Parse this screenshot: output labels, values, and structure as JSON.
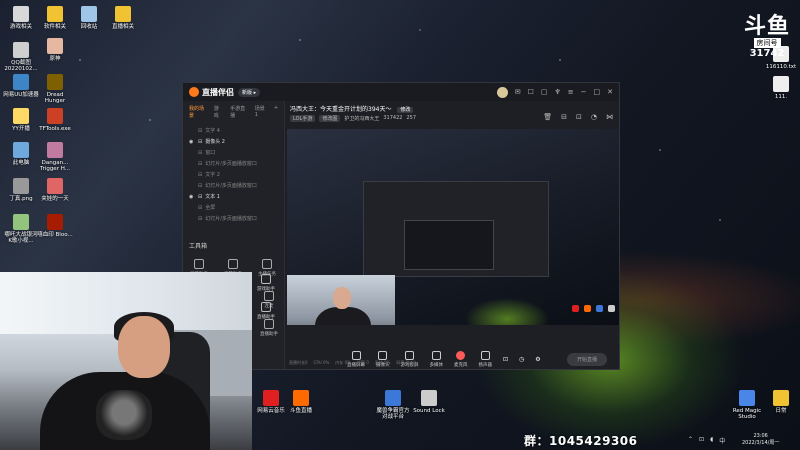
{
  "desktop": {
    "icons": [
      {
        "label": "游戏相关",
        "color": "#d8d8d8"
      },
      {
        "label": "软件相关",
        "color": "#f1c232"
      },
      {
        "label": "回收站",
        "color": "#9fc5e8"
      },
      {
        "label": "直播相关",
        "color": "#f1c232"
      },
      {
        "label": "QQ截图 20220102...",
        "color": "#cfcfcf"
      },
      {
        "label": "原神",
        "color": "#e6b8a2"
      },
      {
        "label": "网易UU加速器",
        "color": "#3d85c6"
      },
      {
        "label": "Dread Hunger",
        "color": "#7f6000"
      },
      {
        "label": "YY开播",
        "color": "#ffd966"
      },
      {
        "label": "TFTools.exe",
        "color": "#cc4125"
      },
      {
        "label": "此电脑",
        "color": "#6fa8dc"
      },
      {
        "label": "Dangan... Trigger H...",
        "color": "#c27ba0"
      },
      {
        "label": "丁真.png",
        "color": "#999999"
      },
      {
        "label": "夹娃的一天",
        "color": "#e06666"
      },
      {
        "label": "哪吒大战银河 K歌小视...",
        "color": "#93c47d"
      },
      {
        "label": "嘻血印 Bloo...",
        "color": "#a61c00"
      }
    ],
    "right_icons": [
      {
        "label": "116110.txt",
        "color": "#eeeeee"
      },
      {
        "label": "111.",
        "color": "#eeeeee"
      }
    ],
    "taskbar_icons": [
      {
        "label": "网易云音乐",
        "color": "#e02020"
      },
      {
        "label": "斗鱼直播",
        "color": "#ff6a00"
      },
      {
        "label": "魔兽争霸官方 对战平台",
        "color": "#3c78d8"
      },
      {
        "label": "Sound Lock",
        "color": "#cccccc"
      },
      {
        "label": "Red Magic Studio",
        "color": "#4a86e8"
      },
      {
        "label": "日常",
        "color": "#f1c232"
      }
    ],
    "qq_group": "群：1045429306",
    "clock_time": "23:06",
    "clock_date": "2022/3/14/周一"
  },
  "douyu": {
    "logo": "斗鱼",
    "room_label": "房间号",
    "room_id": "31742"
  },
  "app": {
    "title": "直播伴侣",
    "version": "新版 ▸",
    "tabs": [
      "我的场景",
      "游戏",
      "手游直播",
      "场景1"
    ],
    "scenes": [
      {
        "name": "文字 4",
        "visible": false
      },
      {
        "name": "摄像头 2",
        "visible": true
      },
      {
        "name": "窗口",
        "visible": false
      },
      {
        "name": "幻灯片/多页面播放窗口",
        "visible": false
      },
      {
        "name": "文字 2",
        "visible": false
      },
      {
        "name": "幻灯片/多页面播放窗口",
        "visible": false
      },
      {
        "name": "文本 1",
        "visible": true
      },
      {
        "name": "全屏",
        "visible": false
      },
      {
        "name": "幻灯片/多页面播放窗口",
        "visible": false
      }
    ],
    "toolbox_title": "工具箱",
    "tools": [
      "弹幕助手",
      "房管助手",
      "主播任务"
    ],
    "vtools": [
      "连麦",
      "直播助手"
    ],
    "room_title": "冯西大王：今天重金开计划的394天～",
    "room_tag": "修改",
    "room_meta": [
      "LOL手游",
      "修改图",
      "护卫的冯西大王",
      "317422",
      "257"
    ],
    "bottom_tools": [
      "直播屏幕",
      "摄像头",
      "游戏投屏",
      "多媒体",
      "麦克风",
      "扬声器"
    ],
    "go_live": "开始直播",
    "status": [
      "直播时长0",
      "CPU 0%",
      "内存 0%",
      "帧率 0",
      "丢帧 0%",
      "码率 0kb/s"
    ]
  },
  "side_tools": [
    "游戏助手",
    "直播助手"
  ]
}
